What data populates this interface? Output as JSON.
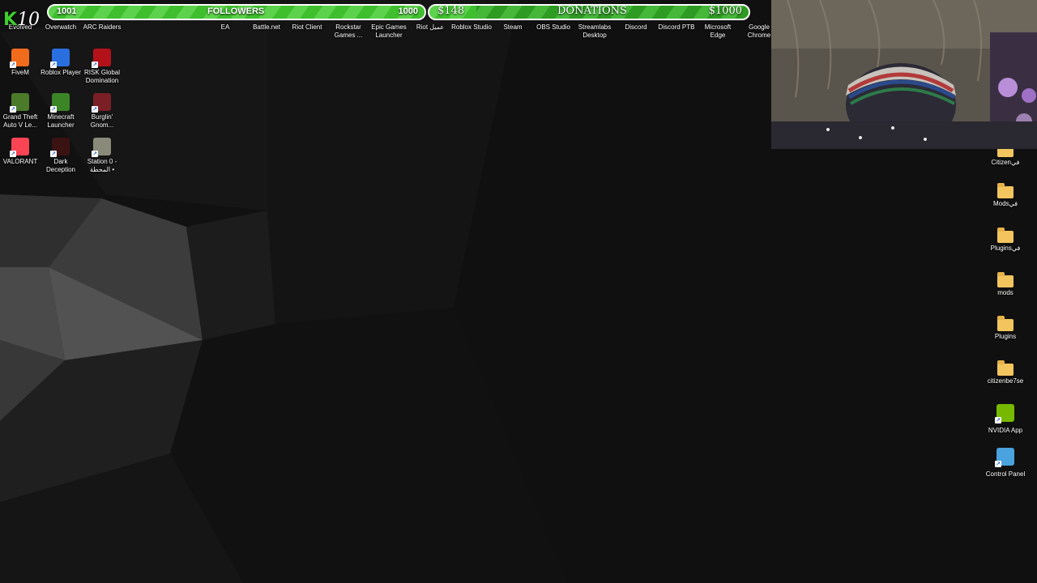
{
  "overlay": {
    "k10_prefix": "K",
    "k10_suffix": "10",
    "followers_current": "1001",
    "followers_label": "FOLLOWERS",
    "followers_goal": "1000",
    "followers_progress": 1.0,
    "donations_current": "$148",
    "donations_label": "DONATIONS",
    "donations_goal": "$1000",
    "donations_progress": 0.148
  },
  "desktop": {
    "top_row": [
      {
        "label": "Evolved",
        "icon": "ark-icon",
        "color": "#333333"
      },
      {
        "label": "Overwatch",
        "icon": "overwatch-icon",
        "color": "#f99e1a"
      },
      {
        "label": "ARC Raiders",
        "icon": "arc-raiders-icon",
        "color": "#c0392b"
      },
      {
        "label": "EA",
        "icon": "ea-icon",
        "color": "#ff4747"
      },
      {
        "label": "Battle.net",
        "icon": "battlenet-icon",
        "color": "#148eff"
      },
      {
        "label": "Riot Client",
        "icon": "riot-icon",
        "color": "#d13639"
      },
      {
        "label": "Rockstar Games ...",
        "icon": "rockstar-icon",
        "color": "#fcaf17"
      },
      {
        "label": "Epic Games Launcher",
        "icon": "epic-icon",
        "color": "#2a2a2a"
      },
      {
        "label": "Riot عميل",
        "icon": "riot-icon",
        "color": "#d13639"
      },
      {
        "label": "Roblox Studio",
        "icon": "roblox-studio-icon",
        "color": "#00a2ff"
      },
      {
        "label": "Steam",
        "icon": "steam-icon",
        "color": "#1b2838"
      },
      {
        "label": "OBS Studio",
        "icon": "obs-icon",
        "color": "#302e31"
      },
      {
        "label": "Streamlabs Desktop",
        "icon": "streamlabs-icon",
        "color": "#31c3a2"
      },
      {
        "label": "Discord",
        "icon": "discord-icon",
        "color": "#5865f2"
      },
      {
        "label": "Discord PTB",
        "icon": "discord-ptb-icon",
        "color": "#5865f2"
      },
      {
        "label": "Microsoft Edge",
        "icon": "edge-icon",
        "color": "#0fa3a8"
      },
      {
        "label": "Google Chrome",
        "icon": "chrome-icon",
        "color": "#db4437"
      }
    ],
    "left_col": [
      {
        "label": "FiveM",
        "icon": "fivem-icon",
        "color": "#f16b1d"
      },
      {
        "label": "Roblox Player",
        "icon": "roblox-icon",
        "color": "#2a6fe0"
      },
      {
        "label": "RISK Global Domination",
        "icon": "risk-icon",
        "color": "#b3121b"
      },
      {
        "label": "Grand Theft Auto V Le...",
        "icon": "gta-icon",
        "color": "#4a7a2a"
      },
      {
        "label": "Minecraft Launcher",
        "icon": "minecraft-icon",
        "color": "#3b8526"
      },
      {
        "label": "Burglin' Gnom...",
        "icon": "burglin-gnomes-icon",
        "color": "#7a1f25"
      },
      {
        "label": "VALORANT",
        "icon": "valorant-icon",
        "color": "#fa4454"
      },
      {
        "label": "Dark Deception",
        "icon": "dark-deception-icon",
        "color": "#3a1212"
      },
      {
        "label": "Station 0 - المحطة •",
        "icon": "station0-icon",
        "color": "#8a8a7a"
      }
    ],
    "right_col": [
      {
        "label": "Citizenفي",
        "icon": "folder-icon",
        "kind": "folder"
      },
      {
        "label": "Modsفي",
        "icon": "folder-icon",
        "kind": "folder"
      },
      {
        "label": "Pluginsفي",
        "icon": "folder-icon",
        "kind": "folder"
      },
      {
        "label": "mods",
        "icon": "folder-icon",
        "kind": "folder"
      },
      {
        "label": "Plugins",
        "icon": "folder-icon",
        "kind": "folder"
      },
      {
        "label": "citizenbe7se",
        "icon": "folder-icon",
        "kind": "folder"
      },
      {
        "label": "NVIDIA App",
        "icon": "nvidia-icon",
        "kind": "app",
        "color": "#76b900"
      },
      {
        "label": "Control Panel",
        "icon": "control-panel-icon",
        "kind": "app",
        "color": "#4aa3df"
      }
    ]
  }
}
